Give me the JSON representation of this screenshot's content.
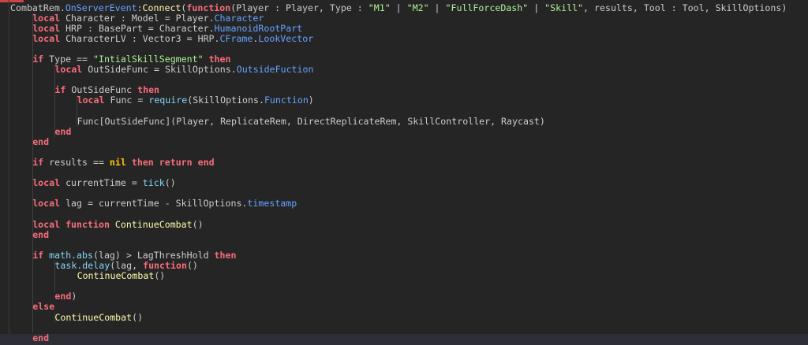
{
  "editor": {
    "colors": {
      "background": "#252525",
      "keyword": "#f86d7c",
      "string": "#adf195",
      "property": "#66a3ff",
      "function": "#fdfbac",
      "builtin": "#84d6f7",
      "nil": "#ffc600",
      "text": "#cccccc"
    },
    "lines": [
      {
        "indent": 0,
        "tokens": [
          [
            "p",
            "CombatRem."
          ],
          [
            "b",
            "OnServerEvent"
          ],
          [
            "p",
            ":"
          ],
          [
            "f",
            "Connect"
          ],
          [
            "p",
            "("
          ],
          [
            "k",
            "function"
          ],
          [
            "p",
            "(Player : Player, Type : "
          ],
          [
            "s",
            "\"M1\""
          ],
          [
            "p",
            " | "
          ],
          [
            "s",
            "\"M2\""
          ],
          [
            "p",
            " | "
          ],
          [
            "s",
            "\"FullForceDash\""
          ],
          [
            "p",
            " | "
          ],
          [
            "s",
            "\"Skill\""
          ],
          [
            "p",
            ", results, Tool : Tool, SkillOptions)"
          ]
        ]
      },
      {
        "indent": 1,
        "tokens": [
          [
            "k",
            "local"
          ],
          [
            "p",
            " Character : Model = Player."
          ],
          [
            "b",
            "Character"
          ]
        ]
      },
      {
        "indent": 1,
        "tokens": [
          [
            "k",
            "local"
          ],
          [
            "p",
            " HRP : BasePart = Character."
          ],
          [
            "b",
            "HumanoidRootPart"
          ]
        ]
      },
      {
        "indent": 1,
        "tokens": [
          [
            "k",
            "local"
          ],
          [
            "p",
            " CharacterLV : Vector3 = HRP."
          ],
          [
            "b",
            "CFrame"
          ],
          [
            "p",
            "."
          ],
          [
            "b",
            "LookVector"
          ]
        ]
      },
      {
        "indent": 0,
        "tokens": []
      },
      {
        "indent": 1,
        "tokens": [
          [
            "k",
            "if"
          ],
          [
            "p",
            " Type == "
          ],
          [
            "s",
            "\"IntialSkillSegment\""
          ],
          [
            "p",
            " "
          ],
          [
            "k",
            "then"
          ]
        ]
      },
      {
        "indent": 2,
        "tokens": [
          [
            "k",
            "local"
          ],
          [
            "p",
            " OutSideFunc = SkillOptions."
          ],
          [
            "b",
            "OutsideFuction"
          ]
        ]
      },
      {
        "indent": 0,
        "tokens": []
      },
      {
        "indent": 2,
        "tokens": [
          [
            "k",
            "if"
          ],
          [
            "p",
            " OutSideFunc "
          ],
          [
            "k",
            "then"
          ]
        ]
      },
      {
        "indent": 3,
        "tokens": [
          [
            "k",
            "local"
          ],
          [
            "p",
            " Func = "
          ],
          [
            "g",
            "require"
          ],
          [
            "p",
            "(SkillOptions."
          ],
          [
            "b",
            "Function"
          ],
          [
            "p",
            ")"
          ]
        ]
      },
      {
        "indent": 0,
        "tokens": []
      },
      {
        "indent": 3,
        "tokens": [
          [
            "p",
            "Func[OutSideFunc](Player, ReplicateRem, DirectReplicateRem, SkillController, Raycast)"
          ]
        ]
      },
      {
        "indent": 2,
        "tokens": [
          [
            "k",
            "end"
          ]
        ]
      },
      {
        "indent": 1,
        "tokens": [
          [
            "k",
            "end"
          ]
        ]
      },
      {
        "indent": 0,
        "tokens": []
      },
      {
        "indent": 1,
        "tokens": [
          [
            "k",
            "if"
          ],
          [
            "p",
            " results == "
          ],
          [
            "n",
            "nil"
          ],
          [
            "p",
            " "
          ],
          [
            "k",
            "then"
          ],
          [
            "p",
            " "
          ],
          [
            "k",
            "return"
          ],
          [
            "p",
            " "
          ],
          [
            "k",
            "end"
          ]
        ]
      },
      {
        "indent": 0,
        "tokens": []
      },
      {
        "indent": 1,
        "tokens": [
          [
            "k",
            "local"
          ],
          [
            "p",
            " currentTime = "
          ],
          [
            "g",
            "tick"
          ],
          [
            "p",
            "()"
          ]
        ]
      },
      {
        "indent": 0,
        "tokens": []
      },
      {
        "indent": 1,
        "tokens": [
          [
            "k",
            "local"
          ],
          [
            "p",
            " lag = currentTime - SkillOptions."
          ],
          [
            "b",
            "timestamp"
          ]
        ]
      },
      {
        "indent": 0,
        "tokens": []
      },
      {
        "indent": 1,
        "tokens": [
          [
            "k",
            "local"
          ],
          [
            "p",
            " "
          ],
          [
            "k",
            "function"
          ],
          [
            "p",
            " "
          ],
          [
            "f",
            "ContinueCombat"
          ],
          [
            "p",
            "()"
          ]
        ]
      },
      {
        "indent": 1,
        "tokens": [
          [
            "k",
            "end"
          ]
        ]
      },
      {
        "indent": 0,
        "tokens": []
      },
      {
        "indent": 1,
        "tokens": [
          [
            "k",
            "if"
          ],
          [
            "p",
            " "
          ],
          [
            "g",
            "math.abs"
          ],
          [
            "p",
            "(lag) > LagThreshHold "
          ],
          [
            "k",
            "then"
          ]
        ]
      },
      {
        "indent": 2,
        "tokens": [
          [
            "g",
            "task.delay"
          ],
          [
            "p",
            "(lag, "
          ],
          [
            "k",
            "function"
          ],
          [
            "p",
            "()"
          ]
        ]
      },
      {
        "indent": 3,
        "tokens": [
          [
            "f",
            "ContinueCombat"
          ],
          [
            "p",
            "()"
          ]
        ]
      },
      {
        "indent": 0,
        "tokens": []
      },
      {
        "indent": 2,
        "tokens": [
          [
            "k",
            "end"
          ],
          [
            "p",
            ")"
          ]
        ]
      },
      {
        "indent": 1,
        "tokens": [
          [
            "k",
            "else"
          ]
        ]
      },
      {
        "indent": 2,
        "tokens": [
          [
            "f",
            "ContinueCombat"
          ],
          [
            "p",
            "()"
          ]
        ]
      },
      {
        "indent": 0,
        "tokens": []
      },
      {
        "indent": 1,
        "tokens": [
          [
            "k",
            "end"
          ]
        ]
      }
    ]
  }
}
